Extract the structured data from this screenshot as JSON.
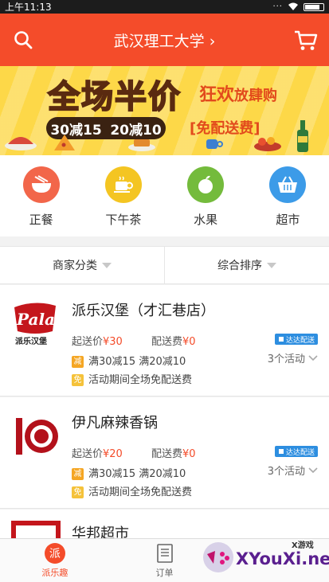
{
  "status_bar": {
    "time": "上午11:13",
    "dots": "···"
  },
  "header": {
    "title": "武汉理工大学 ›"
  },
  "banner": {
    "main": "全场半价",
    "sub_big": "狂欢",
    "sub_small": "放肆购",
    "deal1": "30减15",
    "deal2": "20减10",
    "bracket": "[免配送费]"
  },
  "categories": [
    {
      "label": "正餐",
      "color": "#f2664a",
      "icon": "bowl-icon"
    },
    {
      "label": "下午茶",
      "color": "#f4c522",
      "icon": "coffee-cup-icon"
    },
    {
      "label": "水果",
      "color": "#74bb3c",
      "icon": "apple-icon"
    },
    {
      "label": "超市",
      "color": "#3c9be8",
      "icon": "basket-icon"
    }
  ],
  "filters": {
    "category": "商家分类",
    "sort": "综合排序"
  },
  "shops": [
    {
      "name": "派乐汉堡（才汇巷店）",
      "min_label": "起送价",
      "min_price": "¥30",
      "fee_label": "配送费",
      "fee": "¥0",
      "badge": "达达配送",
      "promo1_tag": "减",
      "promo1": "满30减15 满20减10",
      "promo2_tag": "免",
      "promo2": "活动期间全场免配送费",
      "activities": "3个活动",
      "logo_text": "Pala",
      "logo_sub": "派乐汉堡"
    },
    {
      "name": "伊凡麻辣香锅",
      "min_label": "起送价",
      "min_price": "¥20",
      "fee_label": "配送费",
      "fee": "¥0",
      "badge": "达达配送",
      "promo1_tag": "减",
      "promo1": "满30减15 满20减10",
      "promo2_tag": "免",
      "promo2": "活动期间全场免配送费",
      "activities": "3个活动"
    },
    {
      "name": "华邦超市"
    }
  ],
  "bottom_nav": [
    {
      "label": "派乐趣",
      "icon_text": "派",
      "active": true
    },
    {
      "label": "订单",
      "active": false
    }
  ],
  "watermark": {
    "site": "XYouXi.net",
    "top": "X游戏"
  },
  "colors": {
    "brand": "#f44c2a",
    "banner": "#fdd848",
    "badge": "#2d8ee0"
  }
}
